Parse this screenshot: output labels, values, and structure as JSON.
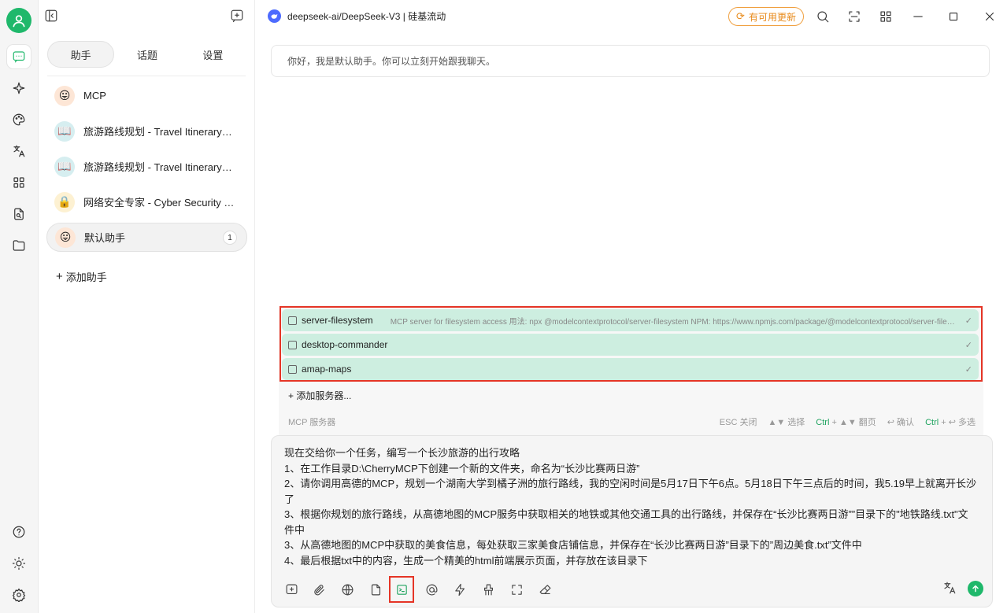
{
  "rail": {
    "items": [
      "chat-icon",
      "sparkle-icon",
      "palette-icon",
      "translate-icon",
      "apps-icon",
      "file-search-icon",
      "folder-icon"
    ],
    "bottom": [
      "help-icon",
      "theme-icon",
      "settings-icon"
    ]
  },
  "sidebar": {
    "tabs": [
      "助手",
      "话题",
      "设置"
    ],
    "assistants": [
      {
        "name": "MCP",
        "emoji": "😛",
        "badge": ""
      },
      {
        "name": "旅游路线规划 - Travel Itinerary Planner",
        "emoji": "📖",
        "badge": ""
      },
      {
        "name": "旅游路线规划 - Travel Itinerary Planner",
        "emoji": "📖",
        "badge": ""
      },
      {
        "name": "网络安全专家 - Cyber Security Expert",
        "emoji": "🔒",
        "badge": ""
      },
      {
        "name": "默认助手",
        "emoji": "😛",
        "badge": "1"
      }
    ],
    "add_label": "添加助手"
  },
  "header": {
    "model_name": "deepseek-ai/DeepSeek-V3 | 硅基流动",
    "update_label": "有可用更新"
  },
  "chat": {
    "greeting": "你好，我是默认助手。你可以立刻开始跟我聊天。"
  },
  "mcp": {
    "servers": [
      {
        "name": "server-filesystem",
        "desc": "MCP server for filesystem access 用法: npx @modelcontextprotocol/server-filesystem NPM: https://www.npmjs.com/package/@modelcontextprotocol/server-filesystem",
        "checked": true
      },
      {
        "name": "desktop-commander",
        "desc": "",
        "checked": true
      },
      {
        "name": "amap-maps",
        "desc": "",
        "checked": true
      }
    ],
    "add_server": "添加服务器...",
    "footer_label": "MCP 服务器",
    "hints": {
      "esc": "ESC 关闭",
      "select": "▲▼ 选择",
      "page_key": "Ctrl",
      "page": "+ ▲▼ 翻页",
      "confirm": "↩ 确认",
      "multi_key": "Ctrl",
      "multi": "+ ↩ 多选"
    },
    "check_mark": "✓"
  },
  "input": {
    "lines": [
      "现在交给你一个任务，编写一个长沙旅游的出行攻略",
      "1、在工作目录D:\\CherryMCP下创建一个新的文件夹，命名为“长沙比赛两日游”",
      "2、请你调用高德的MCP，规划一个湖南大学到橘子洲的旅行路线，我的空闲时间是5月17日下午6点。5月18日下午三点后的时间，我5.19早上就离开长沙了",
      "3、根据你规划的旅行路线，从高德地图的MCP服务中获取相关的地铁或其他交通工具的出行路线，并保存在“长沙比赛两日游””目录下的\"地铁路线.txt\"文件中",
      "3、从高德地图的MCP中获取的美食信息，每处获取三家美食店铺信息，并保存在“长沙比赛两日游”目录下的”周边美食.txt”文件中",
      "4、最后根据txt中的内容，生成一个精美的html前端展示页面，并存放在该目录下"
    ]
  },
  "colors": {
    "accent": "#1fb86b",
    "highlight": "#e53526",
    "server_bg": "#cdeee0",
    "update": "#e88a1a"
  }
}
